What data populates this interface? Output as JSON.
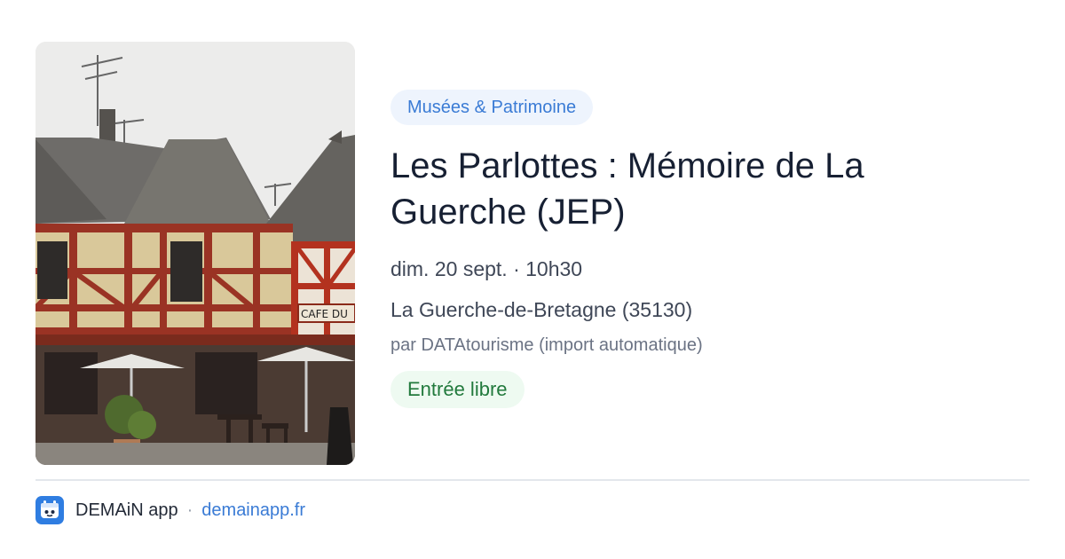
{
  "event": {
    "category": "Musées & Patrimoine",
    "title": "Les Parlottes : Mémoire de La Guerche (JEP)",
    "date": "dim. 20 sept. · 10h30",
    "location": "La Guerche-de-Bretagne (35130)",
    "source": "par DATAtourisme (import automatique)",
    "price": "Entrée libre"
  },
  "photo": {
    "sign_text": "CAFE DU",
    "icon": "half-timbered-building-photo"
  },
  "footer": {
    "app_name": "DEMAiN app",
    "separator": "·",
    "url": "demainapp.fr",
    "icon": "demain-app-logo-icon"
  },
  "colors": {
    "category_bg": "#eef4fd",
    "category_text": "#3a7bd5",
    "price_bg": "#eefaf1",
    "price_text": "#227a3d",
    "title": "#172033",
    "app_icon": "#2f7de1"
  }
}
